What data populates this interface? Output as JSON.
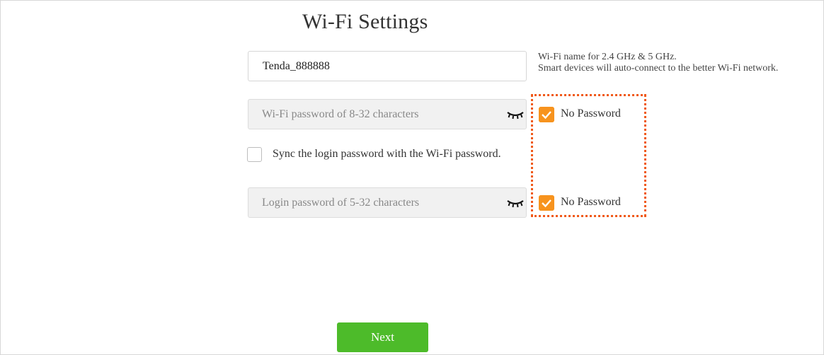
{
  "page": {
    "title": "Wi-Fi Settings"
  },
  "wifi_name": {
    "value": "Tenda_888888",
    "hint_line1": "Wi-Fi name for 2.4 GHz & 5 GHz.",
    "hint_line2": "Smart devices will auto-connect to the better Wi-Fi network."
  },
  "wifi_password": {
    "placeholder": "Wi-Fi password of 8-32 characters",
    "visibility_icon": "eye-closed-icon",
    "no_password_label": "No Password",
    "no_password_checked": true
  },
  "sync": {
    "label": "Sync the login password with the Wi-Fi password.",
    "checked": false
  },
  "login_password": {
    "placeholder": "Login password of 5-32 characters",
    "visibility_icon": "eye-closed-icon",
    "no_password_label": "No Password",
    "no_password_checked": true
  },
  "actions": {
    "next_label": "Next"
  },
  "colors": {
    "accent": "#f7931e",
    "next_button": "#4dbb2a",
    "highlight": "#f05a1a"
  }
}
